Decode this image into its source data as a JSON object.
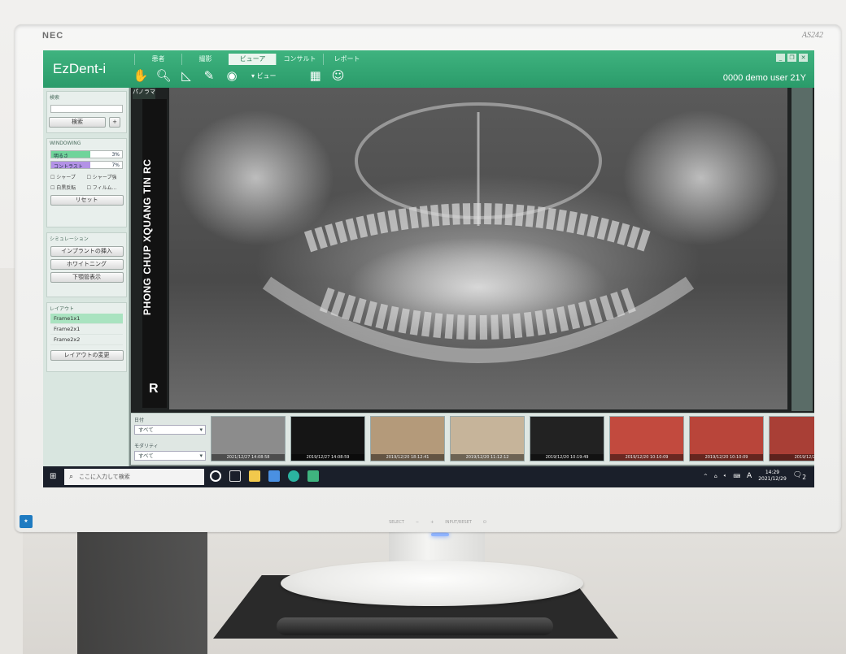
{
  "monitor": {
    "brand": "NEC",
    "model": "AS242"
  },
  "app": {
    "title": "EzDent-i",
    "tabs": [
      "患者",
      "撮影",
      "ビューア",
      "コンサルト",
      "レポート"
    ],
    "active_tab": "ビューア",
    "view_select": "▾ ビュー",
    "user": "0000 demo user 21Y",
    "window_controls": [
      "_",
      "❐",
      "✕"
    ]
  },
  "left_panel": {
    "search": {
      "title": "検索",
      "button": "検索",
      "plus": "+"
    },
    "windowing": {
      "title": "WINDOWING",
      "brightness": {
        "label": "明るさ",
        "value": "3%",
        "level": 0.55
      },
      "contrast": {
        "label": "コントラスト",
        "value": "7%",
        "level": 0.55
      },
      "checks": [
        "シャープ",
        "シャープ強",
        "白黒反転",
        "フィルム..."
      ],
      "reset": "リセット"
    },
    "simulation": {
      "title": "シミュレーション",
      "buttons": [
        "インプラントの挿入",
        "ホワイトニング",
        "下顎管表示"
      ]
    },
    "layout": {
      "title": "レイアウト",
      "frames": [
        "Frame1x1",
        "Frame2x1",
        "Frame2x2"
      ],
      "change_button": "レイアウトの変更"
    }
  },
  "viewer": {
    "caption": "パノラマ",
    "side_text": "PHONG CHUP XQUANG TIN RC",
    "side_marker": "R"
  },
  "bottom": {
    "date_filter": {
      "label": "日付",
      "value": "すべて"
    },
    "modality_filter": {
      "label": "モダリティ",
      "value": "すべて"
    },
    "thumbnails": [
      {
        "date": "2021/12/27 14:08:58",
        "color": "#8c8c8c"
      },
      {
        "date": "2019/12/27 14:08:59",
        "color": "#151515"
      },
      {
        "date": "2019/12/20 18:12:41",
        "color": "#b49a7a"
      },
      {
        "date": "2019/12/20 11:12:12",
        "color": "#c6b49a"
      },
      {
        "date": "2019/12/20 10:19:49",
        "color": "#222222"
      },
      {
        "date": "2019/12/20 10:10:09",
        "color": "#c24a3e"
      },
      {
        "date": "2019/12/20 10:10:09",
        "color": "#b9453a"
      },
      {
        "date": "2019/12/20",
        "color": "#a93f36"
      }
    ]
  },
  "taskbar": {
    "search_placeholder": "ここに入力して検索",
    "ime": "A",
    "time": "14:29",
    "date": "2021/12/29",
    "notifications": "2"
  }
}
